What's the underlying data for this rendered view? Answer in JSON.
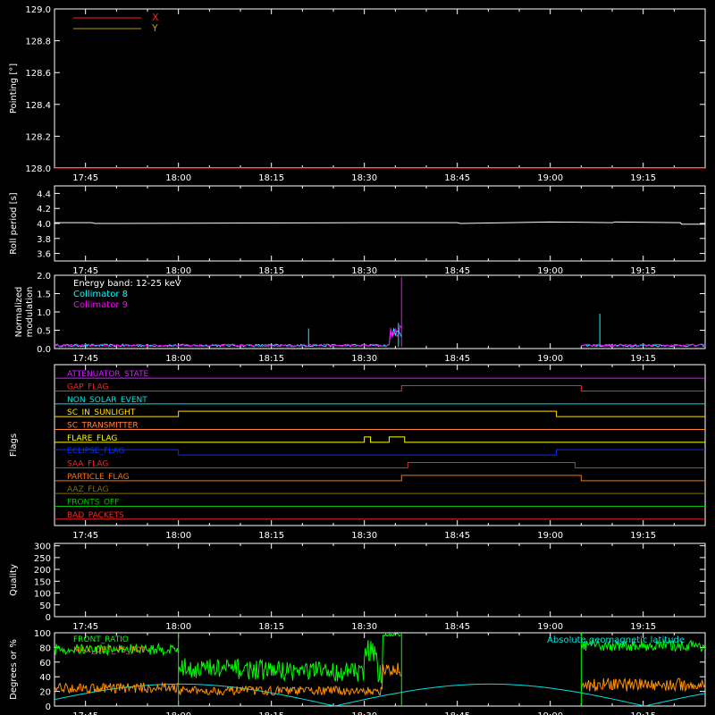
{
  "time_axis": {
    "start": "17:40",
    "end": "19:25",
    "tick_labels": [
      "17:45",
      "18:00",
      "18:15",
      "18:30",
      "18:45",
      "19:00",
      "19:15"
    ]
  },
  "chart_data": [
    {
      "id": "pointing",
      "type": "line",
      "ylabel": "Pointing [°]",
      "ylim": [
        128.0,
        129.0
      ],
      "y_ticks": [
        "129.0",
        "128.8",
        "128.6",
        "128.4",
        "128.2",
        "128.0"
      ],
      "legend": [
        {
          "name": "X",
          "color": "#ff2020"
        },
        {
          "name": "Y",
          "color": "#b0a000"
        }
      ],
      "series": [
        {
          "name": "X",
          "color": "#ff2020",
          "x": [
            "17:40",
            "19:25"
          ],
          "values": [
            128.0,
            128.0
          ]
        },
        {
          "name": "Y",
          "color": "#b0a000",
          "x": [
            "17:40",
            "19:25"
          ],
          "values": [
            128.0,
            128.0
          ]
        }
      ]
    },
    {
      "id": "roll",
      "type": "line",
      "ylabel": "Roll period [s]",
      "ylim": [
        3.5,
        4.5
      ],
      "y_ticks": [
        "4.4",
        "4.2",
        "4.0",
        "3.8",
        "3.6"
      ],
      "series": [
        {
          "name": "roll",
          "color": "#ffffff",
          "x": [
            "17:40",
            "17:46",
            "17:46.5",
            "18:30",
            "18:45",
            "18:45.5",
            "19:00",
            "19:10",
            "19:10.5",
            "19:21",
            "19:21.2",
            "19:25"
          ],
          "values": [
            4.01,
            4.01,
            4.0,
            4.01,
            4.01,
            4.0,
            4.02,
            4.01,
            4.02,
            4.01,
            3.99,
            3.99
          ]
        }
      ]
    },
    {
      "id": "modulation",
      "type": "line",
      "ylabel_lines": [
        "Normalized",
        "modulation"
      ],
      "ylim": [
        0.0,
        2.0
      ],
      "y_ticks": [
        "2.0",
        "1.5",
        "1.0",
        "0.5",
        "0.0"
      ],
      "annotation": "Energy band: 12-25 keV",
      "legend": [
        {
          "name": "Collimator 8",
          "color": "#00ffff"
        },
        {
          "name": "Collimator 9",
          "color": "#ff00ff"
        }
      ],
      "data_segments": [
        [
          "17:40",
          "18:36"
        ],
        [
          "19:05",
          "19:25"
        ]
      ],
      "spikes": [
        {
          "series": "Collimator 8",
          "x": "18:21",
          "value": 0.55
        },
        {
          "series": "Collimator 8",
          "x": "18:35.5",
          "value": 0.7
        },
        {
          "series": "Collimator 9",
          "x": "18:36",
          "value": 1.95
        },
        {
          "series": "Collimator 8",
          "x": "19:08",
          "value": 0.95
        }
      ]
    },
    {
      "id": "flags",
      "type": "line",
      "ylabel": "Flags",
      "flags": [
        {
          "name": "ATTENUATOR_STATE",
          "color": "#d020ff",
          "steps": [
            [
              "17:40",
              0
            ]
          ]
        },
        {
          "name": "GAP_FLAG",
          "color": "#ff2020",
          "steps": [
            [
              "17:40",
              0
            ],
            [
              "18:36",
              1
            ],
            [
              "19:05",
              0
            ]
          ]
        },
        {
          "name": "NON_SOLAR_EVENT",
          "color": "#00e0e0",
          "steps": [
            [
              "17:40",
              0
            ]
          ]
        },
        {
          "name": "SC_IN_SUNLIGHT",
          "color": "#ffe000",
          "steps": [
            [
              "17:40",
              0
            ],
            [
              "18:00",
              1
            ],
            [
              "19:01",
              0
            ]
          ]
        },
        {
          "name": "SC_TRANSMITTER",
          "color": "#ff8040",
          "steps": [
            [
              "17:40",
              0
            ]
          ]
        },
        {
          "name": "FLARE_FLAG",
          "color": "#ffff00",
          "steps": [
            [
              "17:40",
              0
            ],
            [
              "18:30",
              1
            ],
            [
              "18:31",
              0
            ],
            [
              "18:34",
              1
            ],
            [
              "18:36.5",
              0
            ]
          ]
        },
        {
          "name": "ECLIPSE_FLAG",
          "color": "#0030ff",
          "steps": [
            [
              "17:40",
              1
            ],
            [
              "18:00",
              0
            ],
            [
              "19:01",
              1
            ]
          ]
        },
        {
          "name": "SAA_FLAG",
          "color": "#ff2020",
          "steps": [
            [
              "17:40",
              0
            ],
            [
              "18:37",
              1
            ],
            [
              "19:04",
              0
            ]
          ]
        },
        {
          "name": "PARTICLE_FLAG",
          "color": "#ff7000",
          "steps": [
            [
              "17:40",
              0
            ],
            [
              "18:36",
              1
            ],
            [
              "19:05",
              0
            ]
          ]
        },
        {
          "name": "AAZ_FLAG",
          "color": "#807000",
          "steps": [
            [
              "17:40",
              0
            ]
          ]
        },
        {
          "name": "FRONTS_OFF",
          "color": "#00c000",
          "steps": [
            [
              "17:40",
              0
            ]
          ]
        },
        {
          "name": "BAD_PACKETS",
          "color": "#ff2020",
          "steps": [
            [
              "17:40",
              0
            ]
          ]
        }
      ]
    },
    {
      "id": "quality",
      "type": "line",
      "ylabel": "Quality",
      "ylim": [
        0,
        310
      ],
      "y_ticks": [
        "300",
        "250",
        "200",
        "150",
        "100",
        "50",
        "0"
      ],
      "series": []
    },
    {
      "id": "geo",
      "type": "line",
      "ylabel": "Degrees or %",
      "ylim": [
        0,
        100
      ],
      "y_ticks": [
        "100",
        "80",
        "60",
        "40",
        "20",
        "0"
      ],
      "legend": [
        {
          "name": "FRONT_RATIO",
          "color": "#00ff00"
        },
        {
          "name": "MAX_DET_VS_TOT",
          "color": "#ff9000"
        }
      ],
      "annotation_right": "Absolute geomagnetic latitude",
      "annotation_right_color": "#00e0e0",
      "data_segments": [
        [
          "17:40",
          "18:00"
        ],
        [
          "18:00",
          "18:36"
        ],
        [
          "19:05",
          "19:25"
        ]
      ]
    }
  ]
}
